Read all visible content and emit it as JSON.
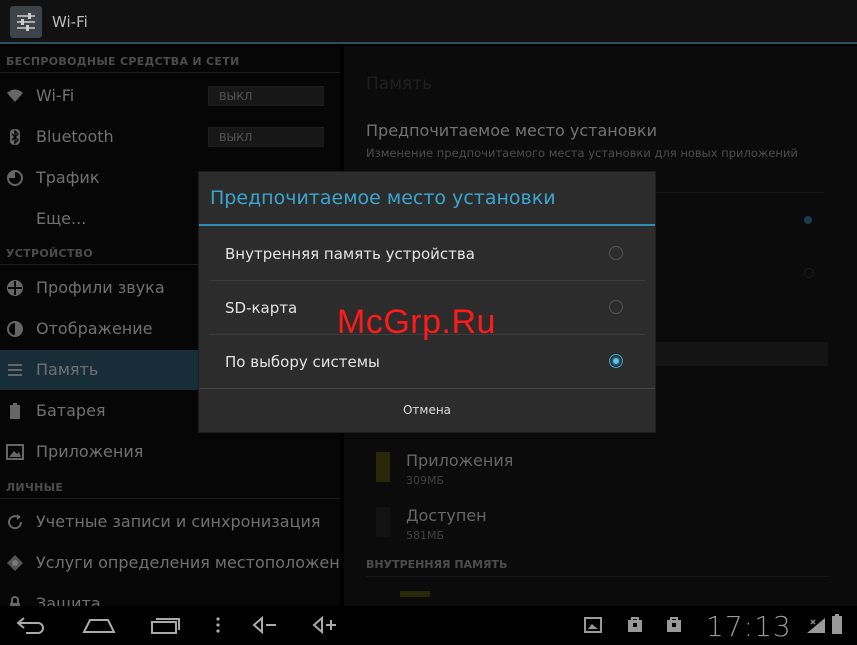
{
  "actionbar": {
    "title": "Wi-Fi",
    "icon": "settings-icon"
  },
  "left_pane": {
    "section_wireless": "БЕСПРОВОДНЫЕ СРЕДСТВА И СЕТИ",
    "wifi_label": "Wi-Fi",
    "wifi_toggle": "ВЫКЛ",
    "bluetooth_label": "Bluetooth",
    "bluetooth_toggle": "ВЫКЛ",
    "traffic_label": "Трафик",
    "more_label": "Еще...",
    "section_device": "УСТРОЙСТВО",
    "sound_label": "Профили звука",
    "display_label": "Отображение",
    "storage_label": "Память",
    "battery_label": "Батарея",
    "apps_label": "Приложения",
    "section_personal": "ЛИЧНЫЕ",
    "accounts_label": "Учетные записи и синхронизация",
    "location_label": "Услуги определения местоположения",
    "security_label": "Защита"
  },
  "right_pane": {
    "header": "Память",
    "pref_title": "Предпочитаемое место установки",
    "pref_subtitle": "Изменение предпочитаемого места установки для новых приложений",
    "apps_name": "Приложения",
    "apps_size": "309МБ",
    "avail_name": "Доступен",
    "avail_size": "581МБ",
    "internal_header": "ВНУТРЕННЯЯ ПАМЯТЬ"
  },
  "dialog": {
    "title": "Предпочитаемое место установки",
    "options": [
      {
        "label": "Внутренняя память устройства",
        "selected": false
      },
      {
        "label": "SD-карта",
        "selected": false
      },
      {
        "label": "По выбору системы",
        "selected": true
      }
    ],
    "cancel": "Отмена"
  },
  "watermark": "McGrp.Ru",
  "systembar": {
    "clock": "17:13",
    "icons": [
      "back-icon",
      "home-icon",
      "recent-apps-icon",
      "menu-icon",
      "volume-down-icon",
      "volume-up-icon",
      "screenshot-icon",
      "shopping-bag-icon",
      "shopping-bag-icon",
      "wifi-signal-icon",
      "battery-icon"
    ]
  },
  "colors": {
    "accent": "#3aa6cf",
    "selected_row": "#2b5466",
    "watermark": "#ff1a1a"
  }
}
